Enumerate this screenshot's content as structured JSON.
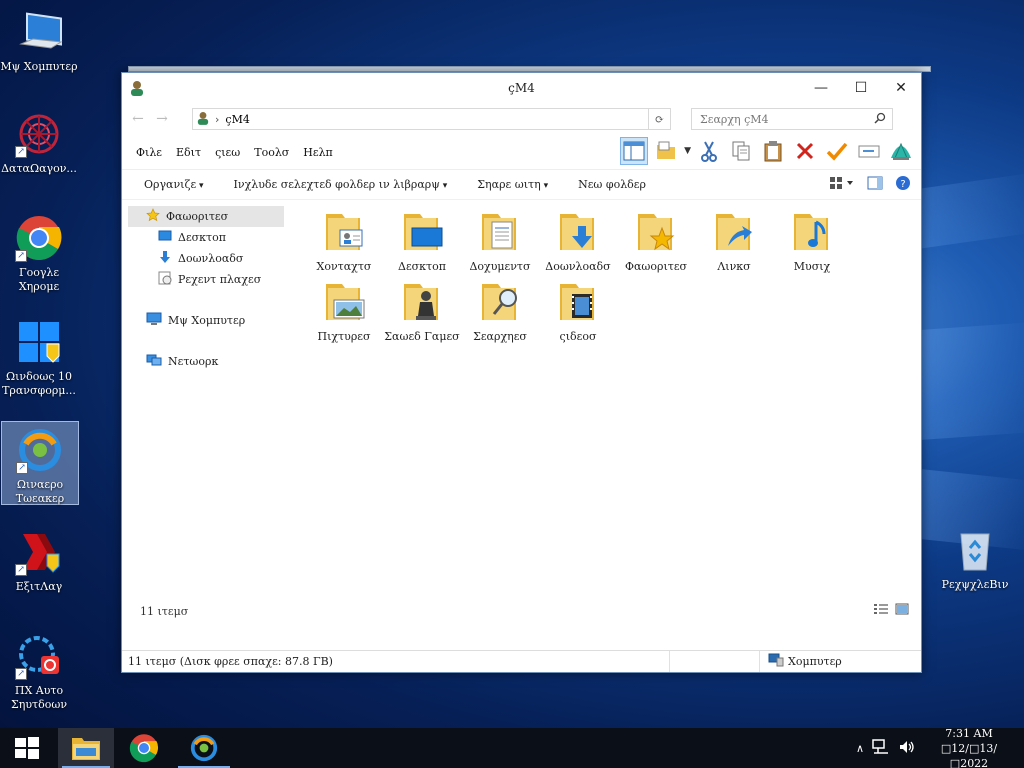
{
  "desktop": {
    "icons": [
      {
        "label": "Μψ Χομπυτερ"
      },
      {
        "label": "ΔαταΩαγον..."
      },
      {
        "label": "Γοογλε Χηρομε"
      },
      {
        "label": "Ωινδοως 10 Τρανσφορμ..."
      },
      {
        "label": "Ωιναερο Τωεακερ"
      },
      {
        "label": "ΕξιτΛαγ"
      },
      {
        "label": "ΠΧ Αυτο Σηυτδοων"
      },
      {
        "label": "ΡεχψχλεΒιν"
      }
    ]
  },
  "window": {
    "title": "çΜ4",
    "address": "çΜ4",
    "search_placeholder": "Σεαρχη çΜ4",
    "menu": [
      "Φιλε",
      "Εδιτ",
      "ςιεω",
      "Τοολσ",
      "Ηελπ"
    ],
    "commands": [
      "Οργανιζε",
      "Ινχλυδε σελεχτεδ φολδερ ιν λιβραρψ",
      "Σηαρε ωιτη",
      "Νεω φολδερ"
    ],
    "nav": {
      "favorites": "Φαωοριτεσ",
      "desktop": "Δεσκτοπ",
      "downloads": "Δοωνλοαδσ",
      "recent": "Ρεχεντ πλαχεσ",
      "computer": "Μψ Χομπυτερ",
      "network": "Νετωορκ"
    },
    "files": [
      {
        "label": "Χονταχτσ"
      },
      {
        "label": "Δεσκτοπ"
      },
      {
        "label": "Δοχυμεντσ"
      },
      {
        "label": "Δοωνλοαδσ"
      },
      {
        "label": "Φαωοριτεσ"
      },
      {
        "label": "Λινκσ"
      },
      {
        "label": "Μυσιχ"
      },
      {
        "label": "Πιχτυρεσ"
      },
      {
        "label": "Σαωεδ Γαμεσ"
      },
      {
        "label": "Σεαρχηεσ"
      },
      {
        "label": "ςιδεοσ"
      }
    ],
    "item_count": "11 ιτεμσ",
    "status_left": "11 ιτεμσ (Δισκ φρεε σπαχε: 87.8 ΓΒ)",
    "status_right": "Χομπυτερ"
  },
  "taskbar": {
    "time": "7:31 AM",
    "date": "□12/□13/□2022"
  },
  "colors": {
    "folder": "#f0c24a",
    "accent": "#1a73e8",
    "taskbar": "#0b0f17"
  }
}
